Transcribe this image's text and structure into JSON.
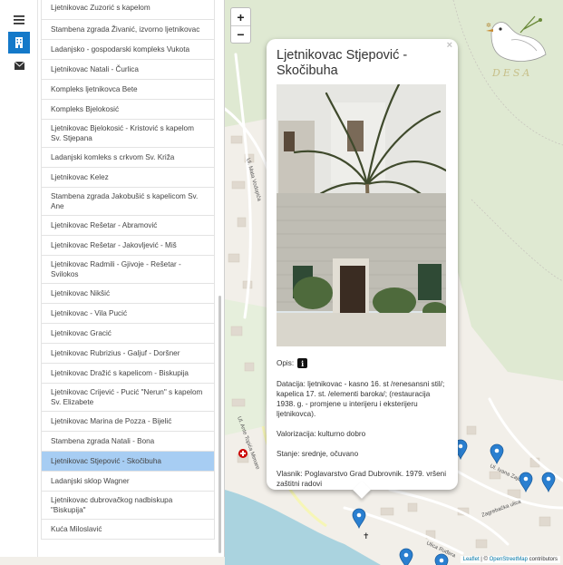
{
  "rail": {
    "buttons": [
      {
        "icon": "menu-icon",
        "active": false
      },
      {
        "icon": "building-icon",
        "active": true
      },
      {
        "icon": "envelope-icon",
        "active": false
      }
    ]
  },
  "list": {
    "items": [
      {
        "label": "Ljetnikovac Zuzorić s kapelom",
        "lines": 1
      },
      {
        "label": "Stambena zgrada Živanić, izvorno ljetnikovac",
        "lines": 1
      },
      {
        "label": "Ladanjsko - gospodarski kompleks Vukota",
        "lines": 1
      },
      {
        "label": "Ljetnikovac Natali - Čurlica",
        "lines": 1
      },
      {
        "label": "Kompleks ljetnikovca Bete",
        "lines": 1
      },
      {
        "label": "Kompleks Bjelokosić",
        "lines": 1
      },
      {
        "label": "Ljetnikovac Bjelokosić - Kristović s kapelom Sv. Stjepana",
        "lines": 2
      },
      {
        "label": "Ladanjski komleks s crkvom Sv. Križa",
        "lines": 1
      },
      {
        "label": "Ljetnikovac Kelez",
        "lines": 1
      },
      {
        "label": "Stambena zgrada Jakobušić s kapelicom Sv. Ane",
        "lines": 2
      },
      {
        "label": "Ljetnikovac Rešetar - Abramović",
        "lines": 1
      },
      {
        "label": "Ljetnikovac Rešetar - Jakovljević - Miš",
        "lines": 1
      },
      {
        "label": "Ljetnikovac Radmili - Gjivoje - Rešetar - Svilokos",
        "lines": 2
      },
      {
        "label": "Ljetnikovac Nikšić",
        "lines": 1
      },
      {
        "label": "Ljetnikovac - Vila Pucić",
        "lines": 1
      },
      {
        "label": "Ljetnikovac Gracić",
        "lines": 1
      },
      {
        "label": "Ljetnikovac Rubrizius - Galjuf - Doršner",
        "lines": 1
      },
      {
        "label": "Ljetnikovac Dražić s kapelicom - Biskupija",
        "lines": 1
      },
      {
        "label": "Ljetnikovac Crijević - Pucić \"Nerun\" s kapelom Sv. Elizabete",
        "lines": 2
      },
      {
        "label": "Ljetnikovac Marina de Pozza - Bijelić",
        "lines": 1
      },
      {
        "label": "Stambena zgrada Natali - Bona",
        "lines": 1
      },
      {
        "label": "Ljetnikovac Stjepović - Skočibuha",
        "lines": 1,
        "selected": true
      },
      {
        "label": "Ladanjski sklop Wagner",
        "lines": 1
      },
      {
        "label": "Ljetnikovac dubrovačkog nadbiskupa \"Biskupija\"",
        "lines": 2
      },
      {
        "label": "Kuća Miloslavić",
        "lines": 1
      }
    ]
  },
  "zoom": {
    "in_label": "+",
    "out_label": "−"
  },
  "popup": {
    "close_label": "×",
    "title": "Ljetnikovac Stjepović - Skočibuha",
    "opis_label": "Opis:",
    "info_glyph": "i",
    "datacija": "Datacija: ljetnikovac - kasno 16. st /renesansni stil/; kapelica 17. st. /elementi baroka/; (restauracija 1938. g. - promjene u interijeru i eksterijeru ljetnikovca).",
    "valorizacija": "Valorizacija: kulturno dobro",
    "stanje": "Stanje: srednje, očuvano",
    "vlasnik": "Vlasnik: Poglavarstvo Grad Dubrovnik. 1979. vršeni zaštitni radovi"
  },
  "logo": {
    "text": "DESA"
  },
  "attribution": {
    "leaflet": "Leaflet",
    "separator": " | © ",
    "osm": "OpenStreetMap",
    "suffix": " contributors"
  },
  "colors": {
    "accent": "#1479c9",
    "selected_row": "#a7cdf3",
    "marker": "#2a7fd0",
    "road": "#ffffff",
    "land": "#f2efe9",
    "green": "#d5e8c8",
    "sea": "#aad3df"
  },
  "map_labels": [
    "Ul. Ante Topića Mimare",
    "Ul. Mata Vodopića",
    "Zagrebačka ulica",
    "Ul. Ivana Zajca",
    "Ulica Ruđera"
  ]
}
